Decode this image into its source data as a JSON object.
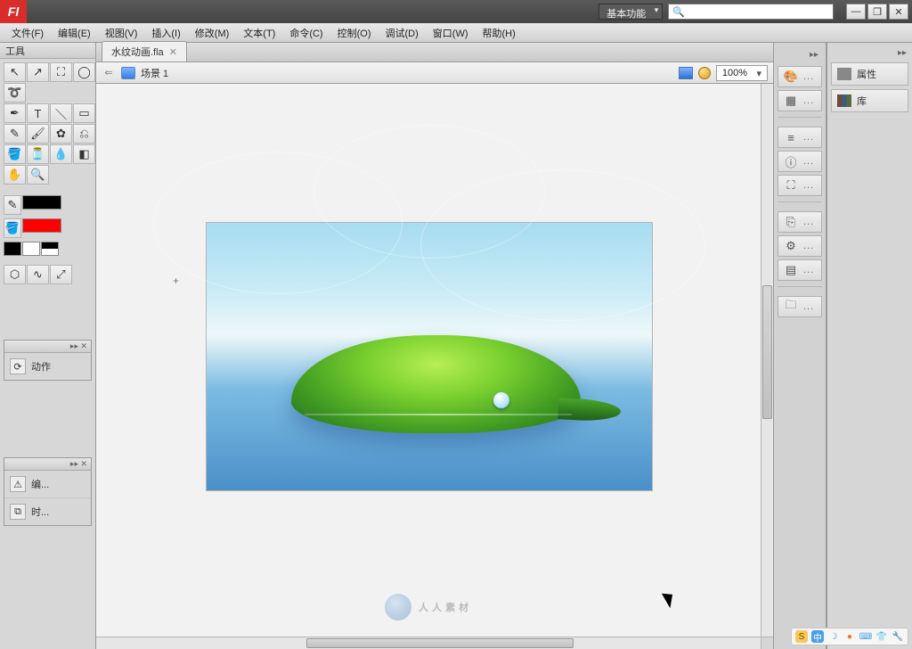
{
  "app": {
    "logo_text": "Fl"
  },
  "header": {
    "workspace_label": "基本功能",
    "search_placeholder": "",
    "win": {
      "min": "—",
      "restore": "❐",
      "close": "✕"
    }
  },
  "menu": [
    "文件(F)",
    "编辑(E)",
    "视图(V)",
    "插入(I)",
    "修改(M)",
    "文本(T)",
    "命令(C)",
    "控制(O)",
    "调试(D)",
    "窗口(W)",
    "帮助(H)"
  ],
  "tools_panel": {
    "title": "工具"
  },
  "mini_panels": {
    "actions": {
      "label": "动作"
    },
    "errors": {
      "label1": "编...",
      "label2": "时..."
    }
  },
  "document": {
    "tab_name": "水纹动画.fla",
    "scene_label": "场景 1",
    "zoom": "100%"
  },
  "right_panel": {
    "properties": "属性",
    "library": "库"
  },
  "dock_ellipsis": "...",
  "watermark": "人人素材",
  "tray": {
    "ime": "S",
    "lang": "中"
  },
  "colors": {
    "accent_red": "#d82d2d"
  }
}
